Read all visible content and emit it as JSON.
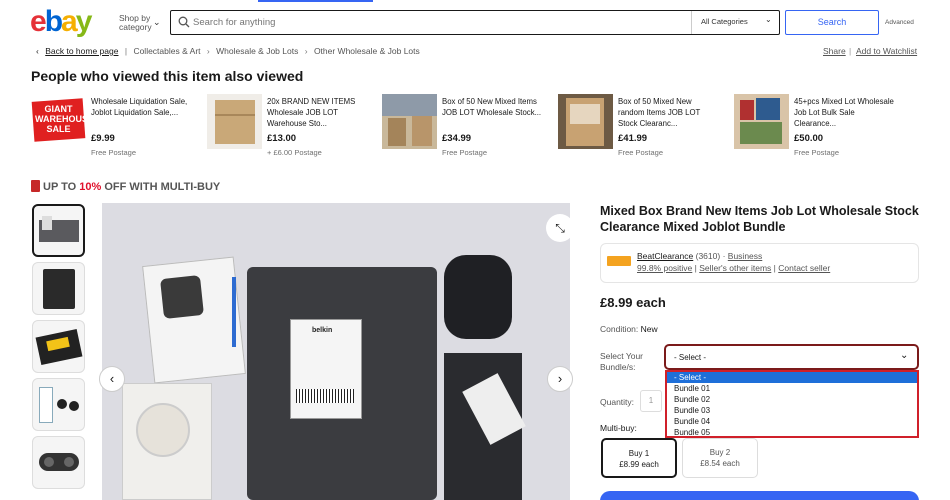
{
  "header": {
    "logo": "ebay",
    "shop_by_line1": "Shop by",
    "shop_by_line2": "category",
    "search_placeholder": "Search for anything",
    "category": "All Categories",
    "search_button": "Search",
    "advanced": "Advanced"
  },
  "breadcrumb": {
    "back": "Back to home page",
    "items": [
      "Collectables & Art",
      "Wholesale & Job Lots",
      "Other Wholesale & Job Lots"
    ],
    "share": "Share",
    "watchlist": "Add to Watchlist"
  },
  "also_viewed": {
    "heading": "People who viewed this item also viewed",
    "items": [
      {
        "title": "Wholesale Liquidation Sale, Joblot Liquidation Sale,...",
        "price": "£9.99",
        "postage": "Free Postage",
        "thumb_text": "GIANT WAREHOUSE SALE"
      },
      {
        "title": "20x BRAND NEW ITEMS Wholesale JOB LOT Warehouse Sto...",
        "price": "£13.00",
        "postage": "+ £6.00 Postage"
      },
      {
        "title": "Box of 50 New Mixed Items JOB LOT Wholesale Stock...",
        "price": "£34.99",
        "postage": "Free Postage"
      },
      {
        "title": "Box of 50 Mixed New random Items JOB LOT Stock Clearanc...",
        "price": "£41.99",
        "postage": "Free Postage"
      },
      {
        "title": "45+pcs Mixed Lot Wholesale Job Lot Bulk Sale Clearance...",
        "price": "£50.00",
        "postage": "Free Postage"
      }
    ]
  },
  "multibuy_banner": {
    "prefix": "UP TO ",
    "pct": "10%",
    "suffix": " OFF WITH MULTI-BUY"
  },
  "product": {
    "title": "Mixed Box Brand New Items Job Lot Wholesale Stock Clearance Mixed Joblot Bundle",
    "seller_name": "BeatClearance",
    "seller_count": "(3610)",
    "seller_type": "Business",
    "positive": "99.8% positive",
    "other_items": "Seller's other items",
    "contact": "Contact seller",
    "price": "£8.99 each",
    "condition_label": "Condition:",
    "condition": "New",
    "bundle_label": "Select Your Bundle/s:",
    "select_value": "- Select -",
    "options": [
      "- Select -",
      "Bundle 01",
      "Bundle 02",
      "Bundle 03",
      "Bundle 04",
      "Bundle 05"
    ],
    "quantity_label": "Quantity:",
    "quantity": "1",
    "multibuy_label": "Multi-buy:",
    "buy_options": [
      {
        "label": "Buy 1",
        "price": "£8.99 each"
      },
      {
        "label": "Buy 2",
        "price": "£8.54 each"
      }
    ],
    "image_label": "belkin"
  }
}
